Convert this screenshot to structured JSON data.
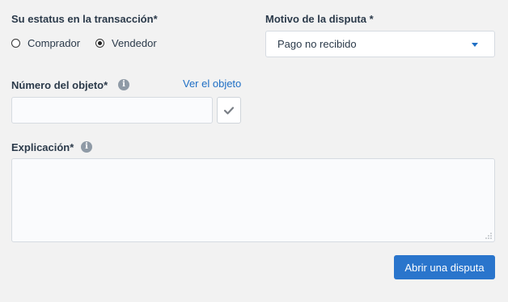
{
  "status": {
    "label": "Su estatus en la transacción*",
    "options": [
      {
        "label": "Comprador",
        "checked": false
      },
      {
        "label": "Vendedor",
        "checked": true
      }
    ]
  },
  "reason": {
    "label": "Motivo de la disputa *",
    "selected": "Pago no recibido"
  },
  "item_number": {
    "label": "Número del objeto*",
    "info_icon": "info-icon",
    "link": "Ver el objeto",
    "value": "",
    "check_icon": "checkmark-icon"
  },
  "explanation": {
    "label": "Explicación*",
    "info_icon": "info-icon",
    "value": ""
  },
  "submit": {
    "label": "Abrir una disputa"
  },
  "colors": {
    "background": "#f2f2f2",
    "accent": "#2a75cc",
    "link": "#1f6fc5"
  }
}
